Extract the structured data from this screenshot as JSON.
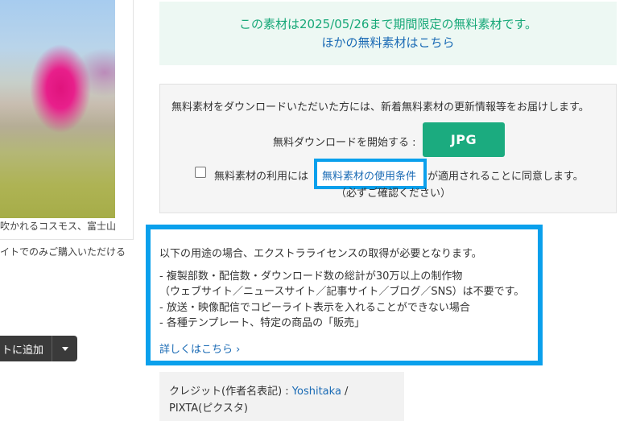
{
  "left": {
    "caption": "吹かれるコスモス、富士山",
    "sub_caption": "イトでのみご購入いただける",
    "cart_button_label": "トに追加",
    "cart_dropdown_icon": "caret-down-icon"
  },
  "notice": {
    "line1": "この素材は2025/05/26まで期間限定の無料素材です。",
    "line2": "ほかの無料素材はこちら"
  },
  "download": {
    "intro": "無料素材をダウンロードいただいた方には、新着無料素材の更新情報等をお届けします。",
    "start_label": "無料ダウンロードを開始する :",
    "jpg_button": "JPG",
    "agree_prefix": "無料素材の利用には",
    "terms_link": "無料素材の使用条件",
    "agree_suffix": "が適用されることに同意します。",
    "agree_note": "（必ずご確認ください）"
  },
  "license": {
    "title": "以下の用途の場合、エクストラライセンスの取得が必要となります。",
    "items": [
      "- 複製部数・配信数・ダウンロード数の総計が30万以上の制作物",
      "（ウェブサイト／ニュースサイト／記事サイト／ブログ／SNS）は不要です。",
      "- 放送・映像配信でコピーライト表示を入れることができない場合",
      "- 各種テンプレート、特定の商品の「販売」"
    ],
    "details_link": "詳しくはこちら ›"
  },
  "credit": {
    "prefix": "クレジット(作者名表記) : ",
    "author": "Yoshitaka",
    "suffix": " / PIXTA(ピクスタ)"
  },
  "colors": {
    "accent_green": "#1bab7f",
    "link_blue": "#1b6bb5",
    "highlight_blue": "#0aa0ec"
  }
}
